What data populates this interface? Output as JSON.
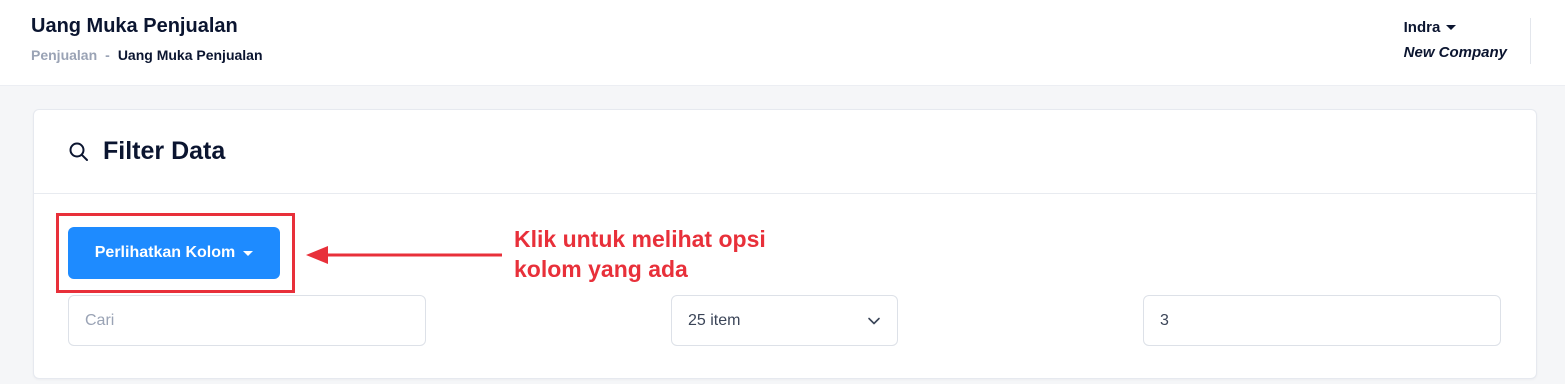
{
  "header": {
    "title": "Uang Muka Penjualan",
    "breadcrumb": {
      "parent": "Penjualan",
      "separator": "-",
      "current": "Uang Muka Penjualan"
    },
    "user": {
      "name": "Indra",
      "company": "New Company"
    }
  },
  "filter": {
    "title": "Filter Data",
    "icon": "search-icon",
    "columns_button": "Perlihatkan Kolom",
    "search_placeholder": "Cari",
    "search_value": "",
    "per_page_value": "25 item",
    "page_value": "3"
  },
  "annotation": {
    "text_line1": "Klik untuk melihat opsi",
    "text_line2": "kolom yang ada",
    "color": "#e8303a"
  },
  "colors": {
    "primary": "#1e8bff",
    "text": "#0b1530",
    "muted": "#9aa3b5"
  }
}
